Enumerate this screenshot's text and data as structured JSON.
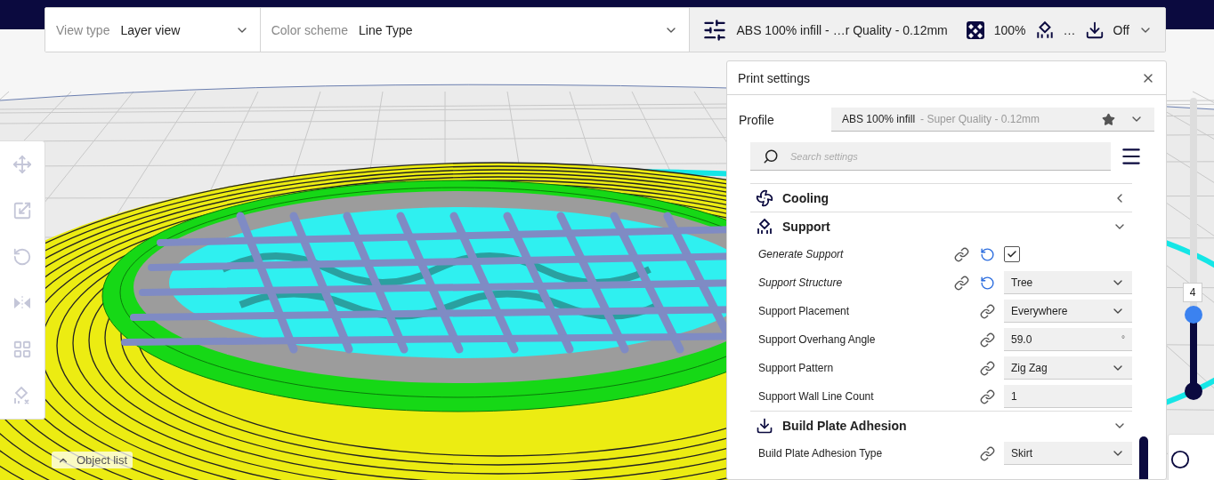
{
  "toolbar": {
    "view_type": {
      "label": "View type",
      "value": "Layer view"
    },
    "color_scheme": {
      "label": "Color scheme",
      "value": "Line Type"
    },
    "print_summary": {
      "profile": "ABS 100% infill - …r Quality - 0.12mm",
      "infill": "100%",
      "support": "…",
      "adhesion": "Off"
    }
  },
  "tool_panel": {
    "tools": [
      {
        "disabled": true
      },
      {
        "disabled": true
      },
      {
        "disabled": true
      },
      {
        "disabled": true
      },
      {
        "disabled": true
      },
      {
        "disabled": true
      }
    ]
  },
  "object_list": {
    "label": "Object list"
  },
  "print_settings": {
    "title": "Print settings",
    "profile": {
      "label": "Profile",
      "name": "ABS 100% infill",
      "quality": "- Super Quality - 0.12mm"
    },
    "search": {
      "placeholder": "Search settings"
    },
    "categories": [
      {
        "name": "Cooling",
        "expanded": false
      },
      {
        "name": "Support",
        "expanded": true,
        "settings": [
          {
            "label": "Generate Support",
            "kind": "checkbox",
            "checked": true,
            "modified": true
          },
          {
            "label": "Support Structure",
            "kind": "dropdown",
            "value": "Tree",
            "modified": true
          },
          {
            "label": "Support Placement",
            "kind": "dropdown",
            "value": "Everywhere",
            "modified": false
          },
          {
            "label": "Support Overhang Angle",
            "kind": "number",
            "value": "59.0",
            "unit": "°",
            "modified": false
          },
          {
            "label": "Support Pattern",
            "kind": "dropdown",
            "value": "Zig Zag",
            "modified": false
          },
          {
            "label": "Support Wall Line Count",
            "kind": "number",
            "value": "1",
            "modified": false
          }
        ]
      },
      {
        "name": "Build Plate Adhesion",
        "expanded": true,
        "settings": [
          {
            "label": "Build Plate Adhesion Type",
            "kind": "dropdown",
            "value": "Skirt",
            "modified": false
          }
        ]
      }
    ]
  },
  "layer_slider": {
    "value": "4",
    "level": 0.26
  }
}
